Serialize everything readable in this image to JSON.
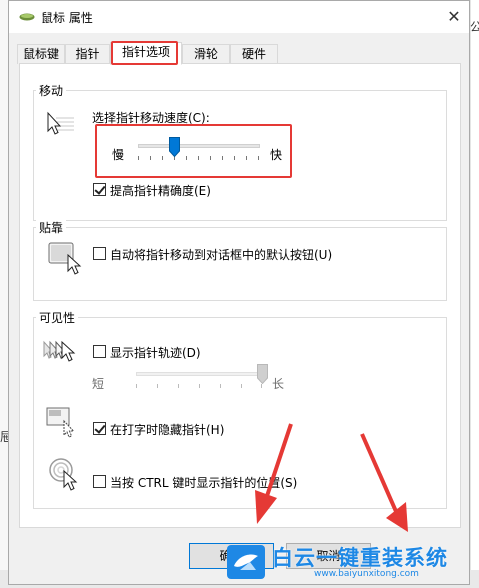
{
  "window": {
    "title": "鼠标 属性",
    "close_glyph": "✕"
  },
  "tabs": [
    {
      "label": "鼠标键",
      "active": false
    },
    {
      "label": "指针",
      "active": false
    },
    {
      "label": "指针选项",
      "active": true
    },
    {
      "label": "滑轮",
      "active": false
    },
    {
      "label": "硬件",
      "active": false
    }
  ],
  "motion": {
    "group_title": "移动",
    "speed_label": "选择指针移动速度(C):",
    "slow_label": "慢",
    "fast_label": "快",
    "speed_level": 0.3,
    "precision_label": "提高指针精确度(E)",
    "precision_checked": true
  },
  "snap": {
    "group_title": "贴靠",
    "snap_label": "自动将指针移动到对话框中的默认按钮(U)",
    "snap_checked": false
  },
  "visibility": {
    "group_title": "可见性",
    "trails_label": "显示指针轨迹(D)",
    "trails_checked": false,
    "short_label": "短",
    "long_label": "长",
    "trails_level": 1.0,
    "hide_label": "在打字时隐藏指针(H)",
    "hide_checked": true,
    "ctrl_label": "当按 CTRL 键时显示指针的位置(S)",
    "ctrl_checked": false
  },
  "buttons": {
    "ok_label": "确定",
    "cancel_label": "取消"
  },
  "watermark": {
    "brand": "白云一键重装系统",
    "url": "www.baiyunxitong.com"
  },
  "background_fragments": {
    "right_top": "公",
    "left_char": "屉"
  },
  "colors": {
    "accent": "#0078d7",
    "highlight": "#e53935",
    "watermark_blue": "#1e88e5"
  }
}
